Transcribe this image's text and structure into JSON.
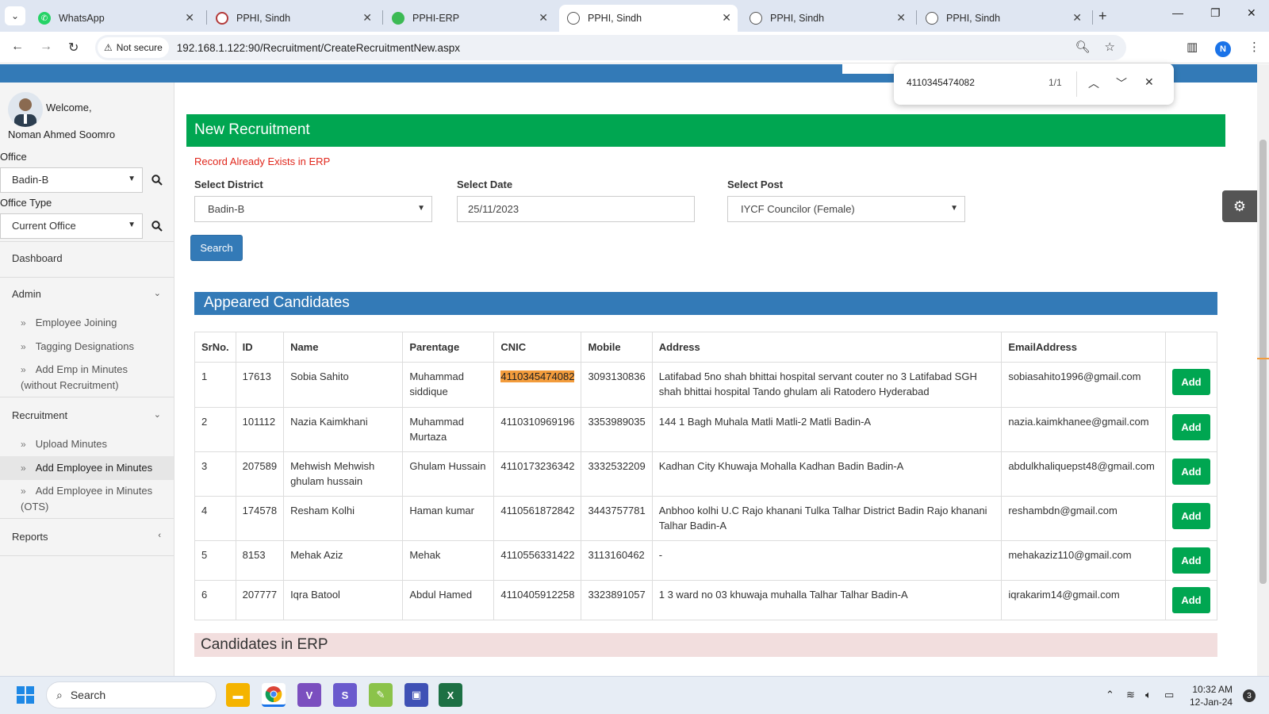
{
  "browser": {
    "tabs": [
      {
        "title": "WhatsApp",
        "icon": "whatsapp-icon",
        "color": "#25d366"
      },
      {
        "title": "PPHI, Sindh",
        "icon": "pphi-icon",
        "color": "#b33a3a"
      },
      {
        "title": "PPHI-ERP",
        "icon": "erp-icon",
        "color": "#3cba54"
      },
      {
        "title": "PPHI, Sindh",
        "icon": "globe-icon",
        "color": "#555555"
      },
      {
        "title": "PPHI, Sindh",
        "icon": "globe-icon",
        "color": "#555555"
      },
      {
        "title": "PPHI, Sindh",
        "icon": "globe-icon",
        "color": "#555555"
      }
    ],
    "active_tab": 3,
    "security_label": "Not secure",
    "url": "192.168.1.122:90/Recruitment/CreateRecruitmentNew.aspx",
    "profile_initial": "N"
  },
  "find": {
    "query": "4110345474082",
    "count": "1/1"
  },
  "sidebar": {
    "welcome": "Welcome,",
    "user_name": "Noman Ahmed Soomro",
    "office_label": "Office",
    "office_value": "Badin-B",
    "office_type_label": "Office Type",
    "office_type_value": "Current Office",
    "dashboard": "Dashboard",
    "admin": "Admin",
    "admin_items": [
      "Employee Joining",
      "Tagging Designations",
      "Add Emp in Minutes",
      "(without Recruitment)"
    ],
    "recruitment": "Recruitment",
    "recruitment_items": [
      "Upload Minutes",
      "Add Employee in Minutes",
      "Add Employee in Minutes",
      "(OTS)"
    ],
    "reports": "Reports"
  },
  "main": {
    "title": "New Recruitment",
    "error": "Record Already Exists in ERP",
    "district_label": "Select District",
    "district_value": "Badin-B",
    "date_label": "Select Date",
    "date_value": "25/11/2023",
    "post_label": "Select Post",
    "post_value": "IYCF Councilor (Female)",
    "search_label": "Search",
    "appeared_title": "Appeared Candidates",
    "erp_title": "Candidates in ERP",
    "add_label": "Add",
    "columns": [
      "SrNo.",
      "ID",
      "Name",
      "Parentage",
      "CNIC",
      "Mobile",
      "Address",
      "EmailAddress",
      ""
    ],
    "rows": [
      {
        "sr": "1",
        "id": "17613",
        "name": "Sobia Sahito",
        "parentage": "Muhammad siddique",
        "cnic": "4110345474082",
        "mobile": "3093130836",
        "address": "Latifabad 5no shah bhittai hospital servant couter no 3 Latifabad SGH shah bhittai hospital Tando ghulam ali Ratodero Hyderabad",
        "email": "sobiasahito1996@gmail.com"
      },
      {
        "sr": "2",
        "id": "101112",
        "name": "Nazia Kaimkhani",
        "parentage": "Muhammad Murtaza",
        "cnic": "4110310969196",
        "mobile": "3353989035",
        "address": "144 1 Bagh Muhala Matli Matli-2 Matli Badin-A",
        "email": "nazia.kaimkhanee@gmail.com"
      },
      {
        "sr": "3",
        "id": "207589",
        "name": "Mehwish Mehwish ghulam hussain",
        "parentage": "Ghulam Hussain",
        "cnic": "4110173236342",
        "mobile": "3332532209",
        "address": "Kadhan City Khuwaja Mohalla Kadhan Badin Badin-A",
        "email": "abdulkhaliquepst48@gmail.com"
      },
      {
        "sr": "4",
        "id": "174578",
        "name": "Resham Kolhi",
        "parentage": "Haman kumar",
        "cnic": "4110561872842",
        "mobile": "3443757781",
        "address": "Anbhoo kolhi U.C Rajo khanani Tulka Talhar District Badin Rajo khanani Talhar Badin-A",
        "email": "reshambdn@gmail.com"
      },
      {
        "sr": "5",
        "id": "8153",
        "name": "Mehak Aziz",
        "parentage": "Mehak",
        "cnic": "4110556331422",
        "mobile": "3113160462",
        "address": "-",
        "email": "mehakaziz110@gmail.com"
      },
      {
        "sr": "6",
        "id": "207777",
        "name": "Iqra Batool",
        "parentage": "Abdul Hamed",
        "cnic": "4110405912258",
        "mobile": "3323891057",
        "address": "1 3 ward no 03 khuwaja muhalla Talhar Talhar Badin-A",
        "email": "iqrakarim14@gmail.com"
      }
    ]
  },
  "taskbar": {
    "search_label": "Search",
    "time": "10:32 AM",
    "date": "12-Jan-24",
    "notifications": "3"
  },
  "colors": {
    "header_green": "#00a651",
    "header_blue": "#337ab7",
    "error_red": "#e0261b",
    "find_highlight": "#f39c3c"
  }
}
